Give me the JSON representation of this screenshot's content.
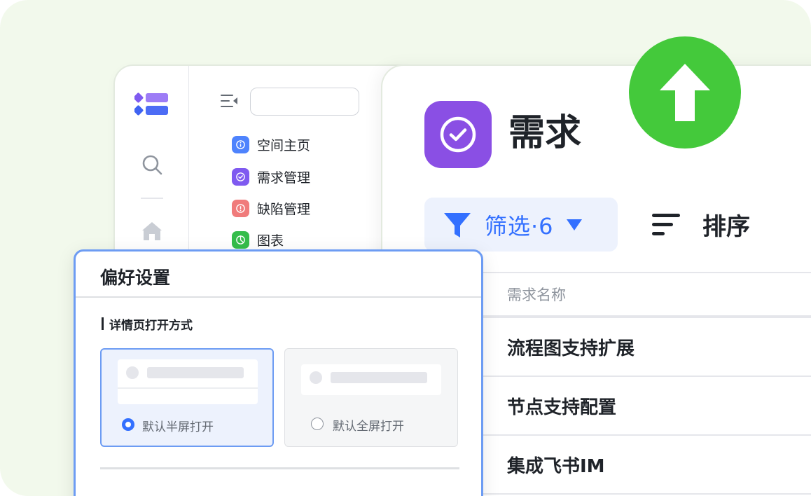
{
  "colors": {
    "background": "#f2f9ec",
    "accent_blue": "#3370ff",
    "requirement_purple": "#8a4fe4",
    "upload_green": "#44c93b",
    "text_primary": "#1f2329",
    "text_secondary": "#8f959e"
  },
  "rail": {
    "icons": [
      "app-logo-icon",
      "search-icon",
      "home-icon"
    ]
  },
  "nav": {
    "search_value": "",
    "items": [
      {
        "label": "空间主页",
        "icon": "info-icon",
        "color": "#4e83fd"
      },
      {
        "label": "需求管理",
        "icon": "check-circle-icon",
        "color": "#7f5af0"
      },
      {
        "label": "缺陷管理",
        "icon": "alert-icon",
        "color": "#f07b7b"
      },
      {
        "label": "图表",
        "icon": "chart-icon",
        "color": "#35bd4b"
      }
    ]
  },
  "main": {
    "title": "需求",
    "filter_label": "筛选·6",
    "sort_label": "排序",
    "table": {
      "header": "需求名称",
      "rows": [
        "流程图支持扩展",
        "节点支持配置",
        "集成飞书IM"
      ]
    }
  },
  "upload_badge": {
    "icon": "upload-arrow-icon"
  },
  "pref_dialog": {
    "title": "偏好设置",
    "section_label": "详情页打开方式",
    "options": [
      {
        "label": "默认半屏打开",
        "selected": true
      },
      {
        "label": "默认全屏打开",
        "selected": false
      }
    ]
  }
}
